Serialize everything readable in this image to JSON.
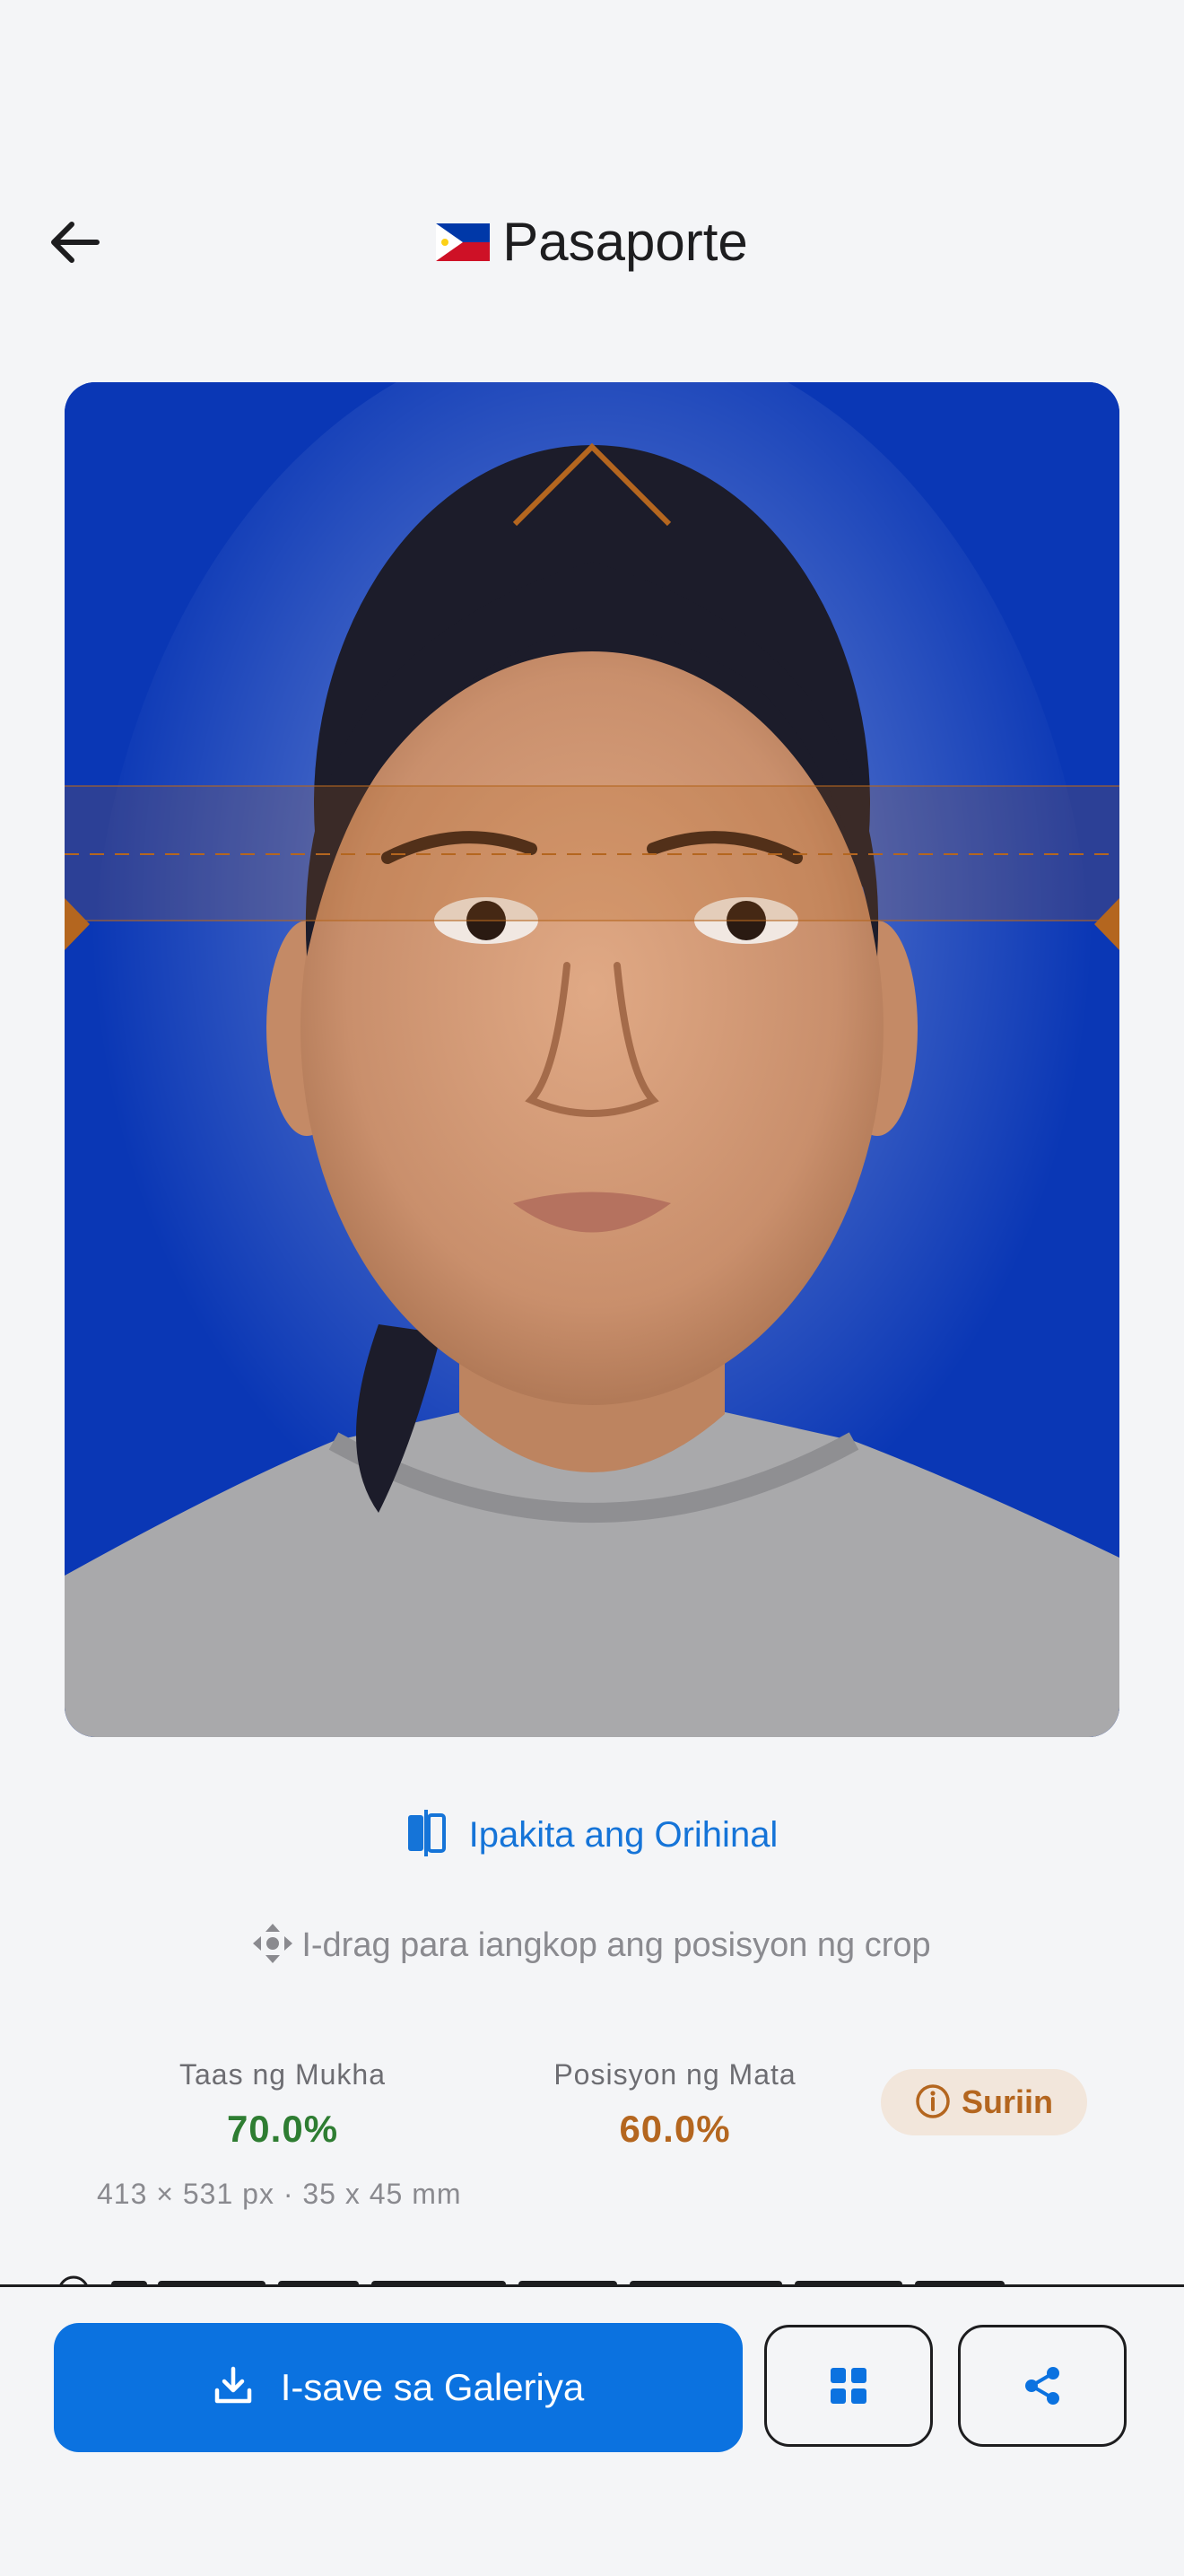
{
  "header": {
    "title": "Pasaporte",
    "flag": "philippines-flag",
    "back_icon": "arrow-left-icon"
  },
  "photo": {
    "background_color": "#0a37b5",
    "guide_color": "#b4661f"
  },
  "toggle": {
    "label": "Ipakita ang Orihinal",
    "icon": "compare-icon"
  },
  "hint": {
    "text": "I-drag para iangkop ang posisyon ng crop",
    "icon": "move-icon"
  },
  "metrics": {
    "face_height": {
      "label": "Taas ng Mukha",
      "value": "70.0%",
      "color": "#2e7d32"
    },
    "eye_position": {
      "label": "Posisyon ng Mata",
      "value": "60.0%",
      "color": "#b4661f"
    }
  },
  "review_badge": {
    "label": "Suriin",
    "icon": "info-icon"
  },
  "dimensions": "413 × 531 px · 35 x 45 mm",
  "actions": {
    "save_label": "I-save sa Galeriya",
    "save_icon": "download-icon",
    "grid_icon": "grid-icon",
    "share_icon": "share-icon"
  },
  "colors": {
    "accent": "#0b72e0",
    "link": "#1574d8",
    "ok": "#2e7d32",
    "warn": "#b4661f"
  }
}
